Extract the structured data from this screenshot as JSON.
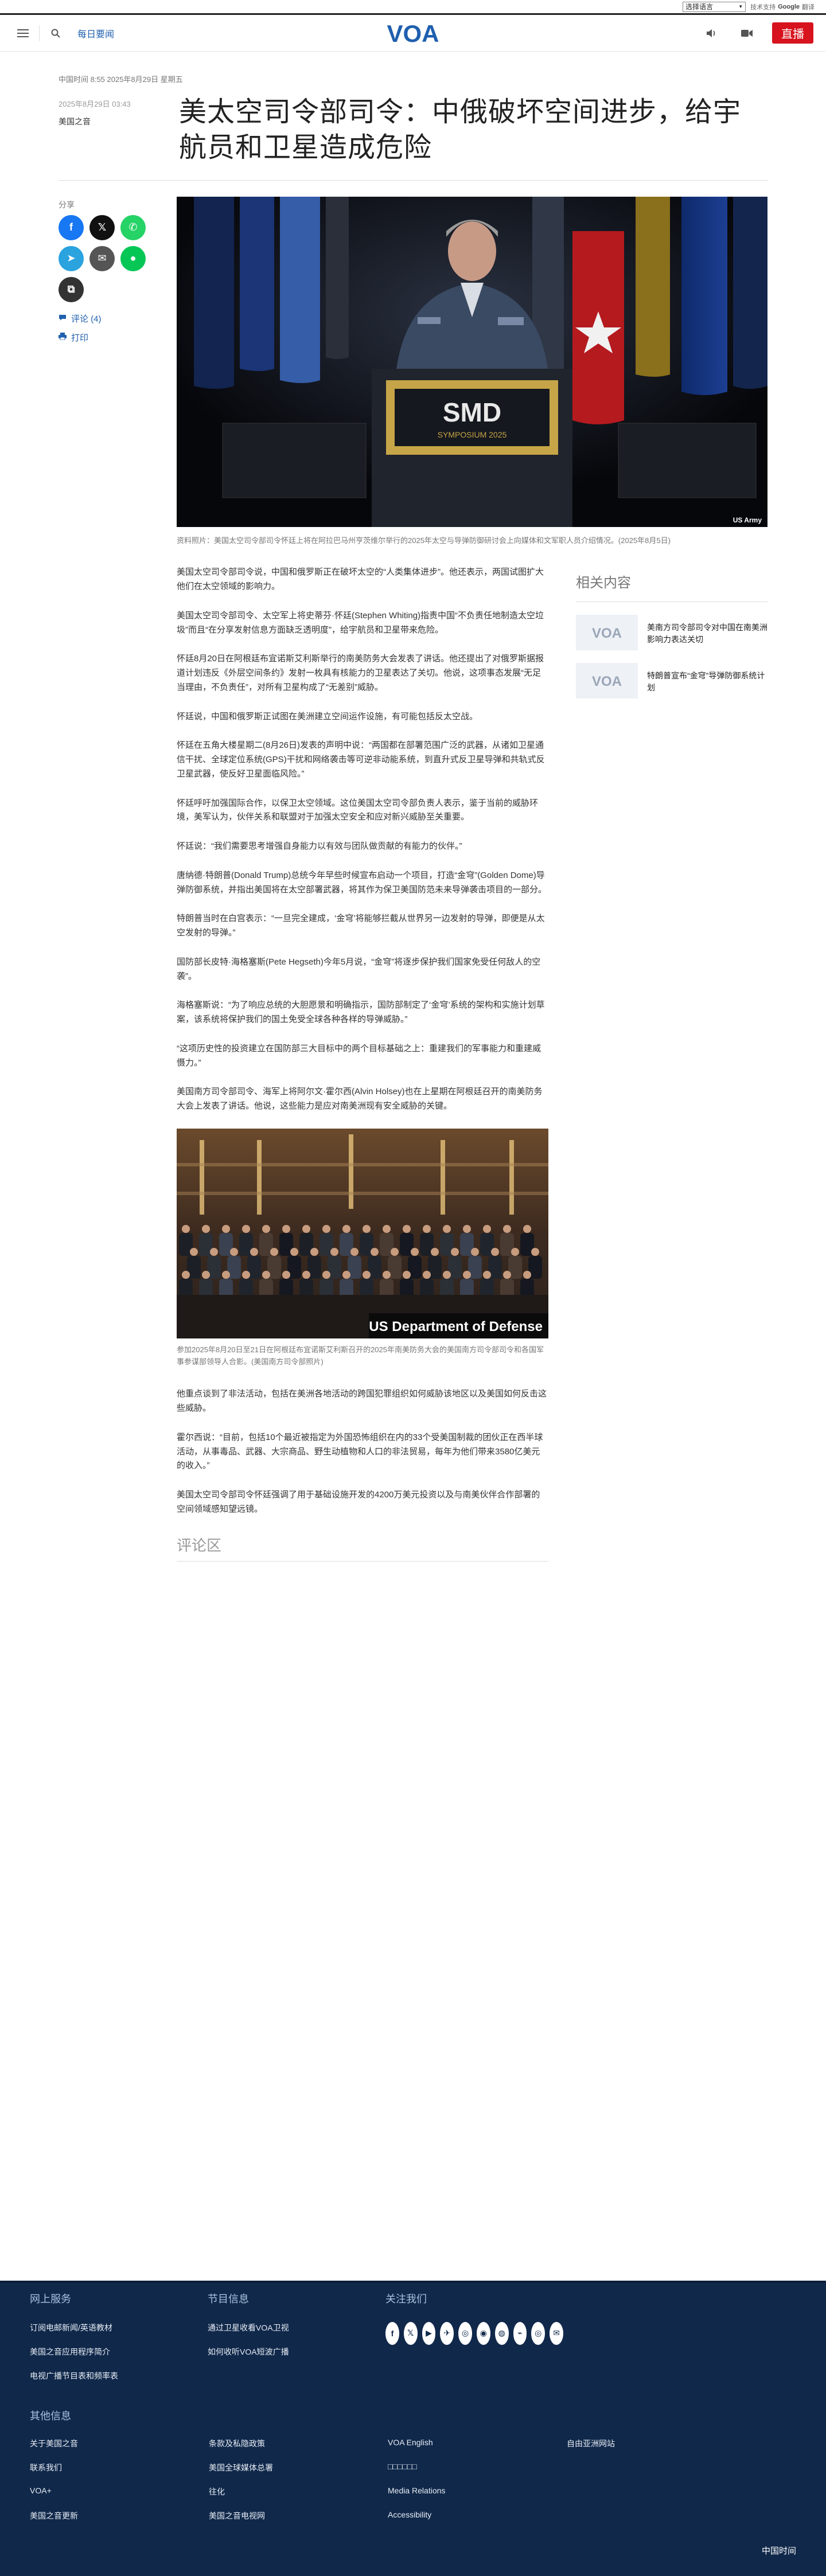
{
  "translate": {
    "select_label": "选择语言",
    "powered": "技术支持",
    "google": "Google",
    "translate_word": "翻译"
  },
  "header": {
    "daily_link": "每日要闻",
    "live_label": "直播",
    "logo_text": "VOA"
  },
  "article": {
    "time_row": "中国时间 8:55 2025年8月29日 星期五",
    "date": "2025年8月29日 03:43",
    "author": "美国之音",
    "headline": "美太空司令部司令：中俄破坏空间进步，给宇航员和卫星造成危险",
    "hero_caption": "资料照片：美国太空司令部司令怀廷上将在阿拉巴马州亨茨维尔举行的2025年太空与导弹防御研讨会上向媒体和文军职人员介绍情况。(2025年8月5日)",
    "hero_watermark": "US Army",
    "podium_text": "SMD",
    "podium_sub": "SYMPOSIUM 2025",
    "paragraphs_a": [
      "美国太空司令部司令说，中国和俄罗斯正在破坏太空的“人类集体进步”。他还表示，两国试图扩大他们在太空领域的影响力。",
      "美国太空司令部司令、太空军上将史蒂芬·怀廷(Stephen Whiting)指责中国“不负责任地制造太空垃圾”而且“在分享发射信息方面缺乏透明度”，给宇航员和卫星带来危险。",
      "怀廷8月20日在阿根廷布宜诺斯艾利斯举行的南美防务大会发表了讲话。他还提出了对俄罗斯据报道计划违反《外层空间条约》发射一枚具有核能力的卫星表达了关切。他说，这项事态发展“无足当理由，不负责任”，对所有卫星构成了“无差别”威胁。",
      "怀廷说，中国和俄罗斯正试图在美洲建立空间运作设施，有可能包括反太空战。",
      "怀廷在五角大楼星期二(8月26日)发表的声明中说：“两国都在部署范围广泛的武器，从诸如卫星通信干扰、全球定位系统(GPS)干扰和网络袭击等可逆非动能系统，到直升式反卫星导弹和共轨式反卫星武器，使反好卫星面临风险。”",
      "怀廷呼吁加强国际合作，以保卫太空领域。这位美国太空司令部负责人表示，鉴于当前的威胁环境，美军认为，伙伴关系和联盟对于加强太空安全和应对新兴威胁至关重要。",
      "怀廷说：“我们需要思考增强自身能力以有效与团队做贡献的有能力的伙伴。”",
      "唐纳德·特朗普(Donald Trump)总统今年早些时候宣布启动一个项目，打造“金穹”(Golden Dome)导弹防御系统，并指出美国将在太空部署武器，将其作为保卫美国防范未来导弹袭击项目的一部分。",
      "特朗普当时在白宫表示：“一旦完全建成，‘金穹’将能够拦截从世界另一边发射的导弹，即便是从太空发射的导弹。”",
      "国防部长皮特·海格塞斯(Pete Hegseth)今年5月说，“金穹”将逐步保护我们国家免受任何敌人的空袭”。",
      "海格塞斯说：“为了响应总统的大胆愿景和明确指示，国防部制定了‘金穹’系统的架构和实施计划草案，该系统将保护我们的国土免受全球各种各样的导弹威胁。”",
      "“这项历史性的投资建立在国防部三大目标中的两个目标基础之上：重建我们的军事能力和重建威慑力。”",
      "美国南方司令部司令、海军上将阿尔文·霍尔西(Alvin Holsey)也在上星期在阿根廷召开的南美防务大会上发表了讲话。他说，这些能力是应对南美洲现有安全威胁的关键。"
    ],
    "inline_caption": "参加2025年8月20日至21日在阿根廷布宜诺斯艾利斯召开的2025年南美防务大会的美国南方司令部司令和各国军事参谋部领导人合影。(美国南方司令部照片)",
    "inline_banner": "US Department of Defense",
    "paragraphs_b": [
      "他重点谈到了非法活动，包括在美洲各地活动的跨国犯罪组织如何威胁该地区以及美国如何反击这些威胁。",
      "霍尔西说：“目前，包括10个最近被指定为外国恐怖组织在内的33个受美国制裁的团伙正在西半球活动，从事毒品、武器、大宗商品、野生动植物和人口的非法贸易，每年为他们带来3580亿美元的收入。”",
      "美国太空司令部司令怀廷强调了用于基础设施开发的4200万美元投资以及与南美伙伴合作部署的空间领域感知望远镜。"
    ],
    "comments_label": "评论区"
  },
  "sidebar": {
    "share_label": "分享",
    "share_buttons": [
      {
        "name": "facebook",
        "glyph": "f",
        "color": "#1877f2"
      },
      {
        "name": "x-twitter",
        "glyph": "𝕏",
        "color": "#111111"
      },
      {
        "name": "whatsapp",
        "glyph": "✆",
        "color": "#25d366"
      },
      {
        "name": "telegram",
        "glyph": "➤",
        "color": "#2aa3df"
      },
      {
        "name": "email",
        "glyph": "✉",
        "color": "#555555"
      },
      {
        "name": "line",
        "glyph": "●",
        "color": "#06c755"
      },
      {
        "name": "copy-link",
        "glyph": "⧉",
        "color": "#333333"
      }
    ],
    "comments_link": "评论 (4)",
    "print_link": "打印"
  },
  "related": {
    "title": "相关内容",
    "items": [
      {
        "title": "美南方司令部司令对中国在南美洲影响力表达关切"
      },
      {
        "title": "特朗普宣布“金穹”导弹防御系统计划"
      }
    ]
  },
  "footer": {
    "col1_title": "网上服务",
    "col1_links": [
      "订阅电邮新闻/英语教材",
      "美国之音应用程序简介",
      "电视广播节目表和频率表"
    ],
    "col2_title": "节目信息",
    "col2_links": [
      "通过卫星收看VOA卫视",
      "如何收听VOA短波广播"
    ],
    "col3_title": "关注我们",
    "social": [
      "f",
      "𝕏",
      "▶",
      "✈",
      "◎",
      "◉",
      "◍",
      "⌁",
      "◎",
      "✉"
    ],
    "other_title": "其他信息",
    "other_links": [
      "关于美国之音",
      "条款及私隐政策",
      "VOA English",
      "自由亚洲网站",
      "联系我们",
      "美国全球媒体总署",
      "□□□□□□",
      "",
      "VOA+",
      "往化",
      "Media Relations",
      "",
      "美国之音更新",
      "美国之音电视网",
      "Accessibility",
      ""
    ],
    "brand": "中国时间"
  },
  "colors": {
    "accent_blue": "#1f5fae",
    "live_red": "#d7131e",
    "footer_navy": "#10284a"
  }
}
